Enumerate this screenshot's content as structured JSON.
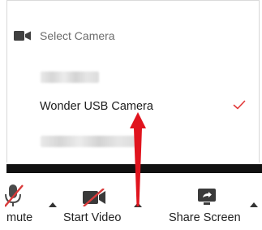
{
  "menu": {
    "title": "Select Camera",
    "header_icon": "video-camera-icon",
    "items": [
      {
        "label": "",
        "selected": false,
        "obscured": true
      },
      {
        "label": "Wonder USB Camera",
        "selected": true,
        "check_icon": "check-icon"
      },
      {
        "label": "",
        "selected": false,
        "obscured": true
      }
    ]
  },
  "toolbar": {
    "buttons": [
      {
        "label": "mute",
        "icon": "microphone-muted-icon"
      },
      {
        "label": "Start Video",
        "icon": "video-off-icon"
      },
      {
        "label": "Share Screen",
        "icon": "share-screen-icon"
      }
    ]
  },
  "colors": {
    "check": "#e23b3b",
    "annotation_arrow": "#e0141e",
    "muted_slash": "#d93a3a",
    "toolbar_divider": "#111111"
  }
}
